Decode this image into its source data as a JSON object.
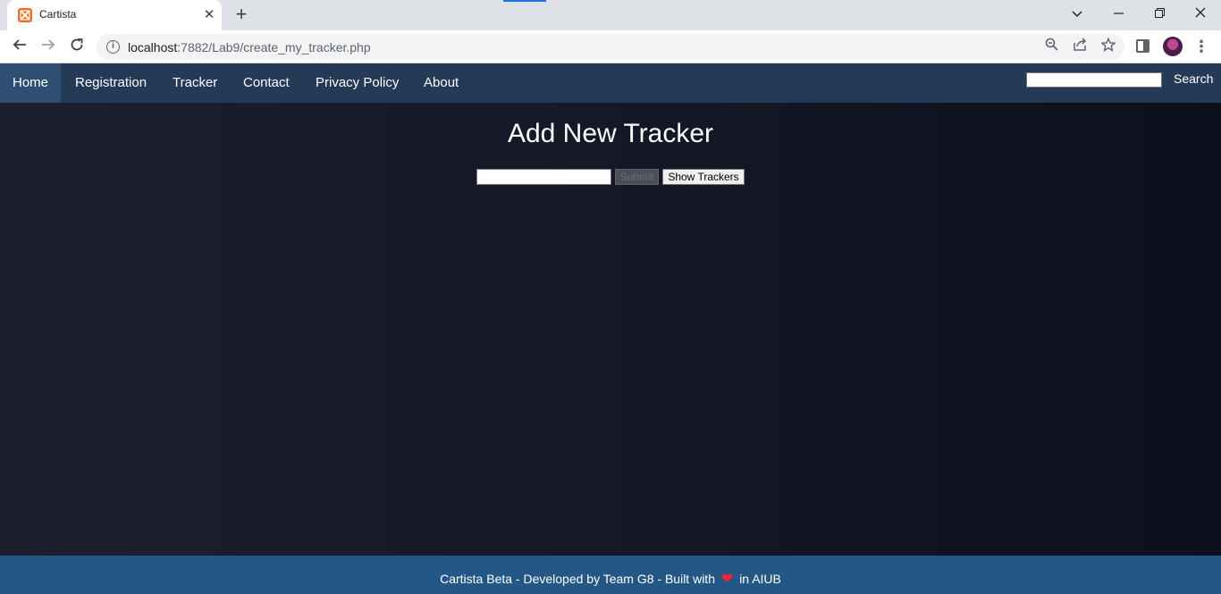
{
  "browser": {
    "tab_title": "Cartista",
    "new_tab_symbol": "+",
    "close_symbol": "✕",
    "url_host": "localhost",
    "url_rest": ":7882/Lab9/create_my_tracker.php"
  },
  "navbar": {
    "items": [
      {
        "label": "Home"
      },
      {
        "label": "Registration"
      },
      {
        "label": "Tracker"
      },
      {
        "label": "Contact"
      },
      {
        "label": "Privacy Policy"
      },
      {
        "label": "About"
      }
    ],
    "search_button": "Search",
    "search_value": ""
  },
  "main": {
    "heading": "Add New Tracker",
    "tracker_input_value": "",
    "submit_label": "Submit",
    "show_trackers_label": "Show Trackers"
  },
  "footer": {
    "text_before": "Cartista Beta - Developed by Team G8 - Built with",
    "heart": "❤",
    "text_after": "in AIUB"
  },
  "colors": {
    "navbar": "#243a57",
    "nav_active": "#2e4e72",
    "page_background": "#141826",
    "footer": "#235886",
    "favicon": "#f26b21"
  }
}
